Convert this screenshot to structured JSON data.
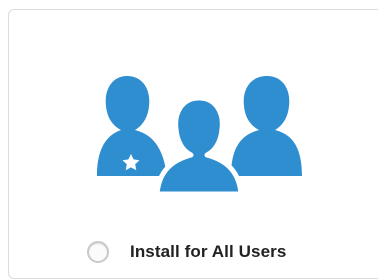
{
  "option": {
    "label": "Install for All Users",
    "selected": false,
    "icon": "users-group-icon",
    "icon_color": "#2f8ed0",
    "badge_icon": "star-icon"
  }
}
